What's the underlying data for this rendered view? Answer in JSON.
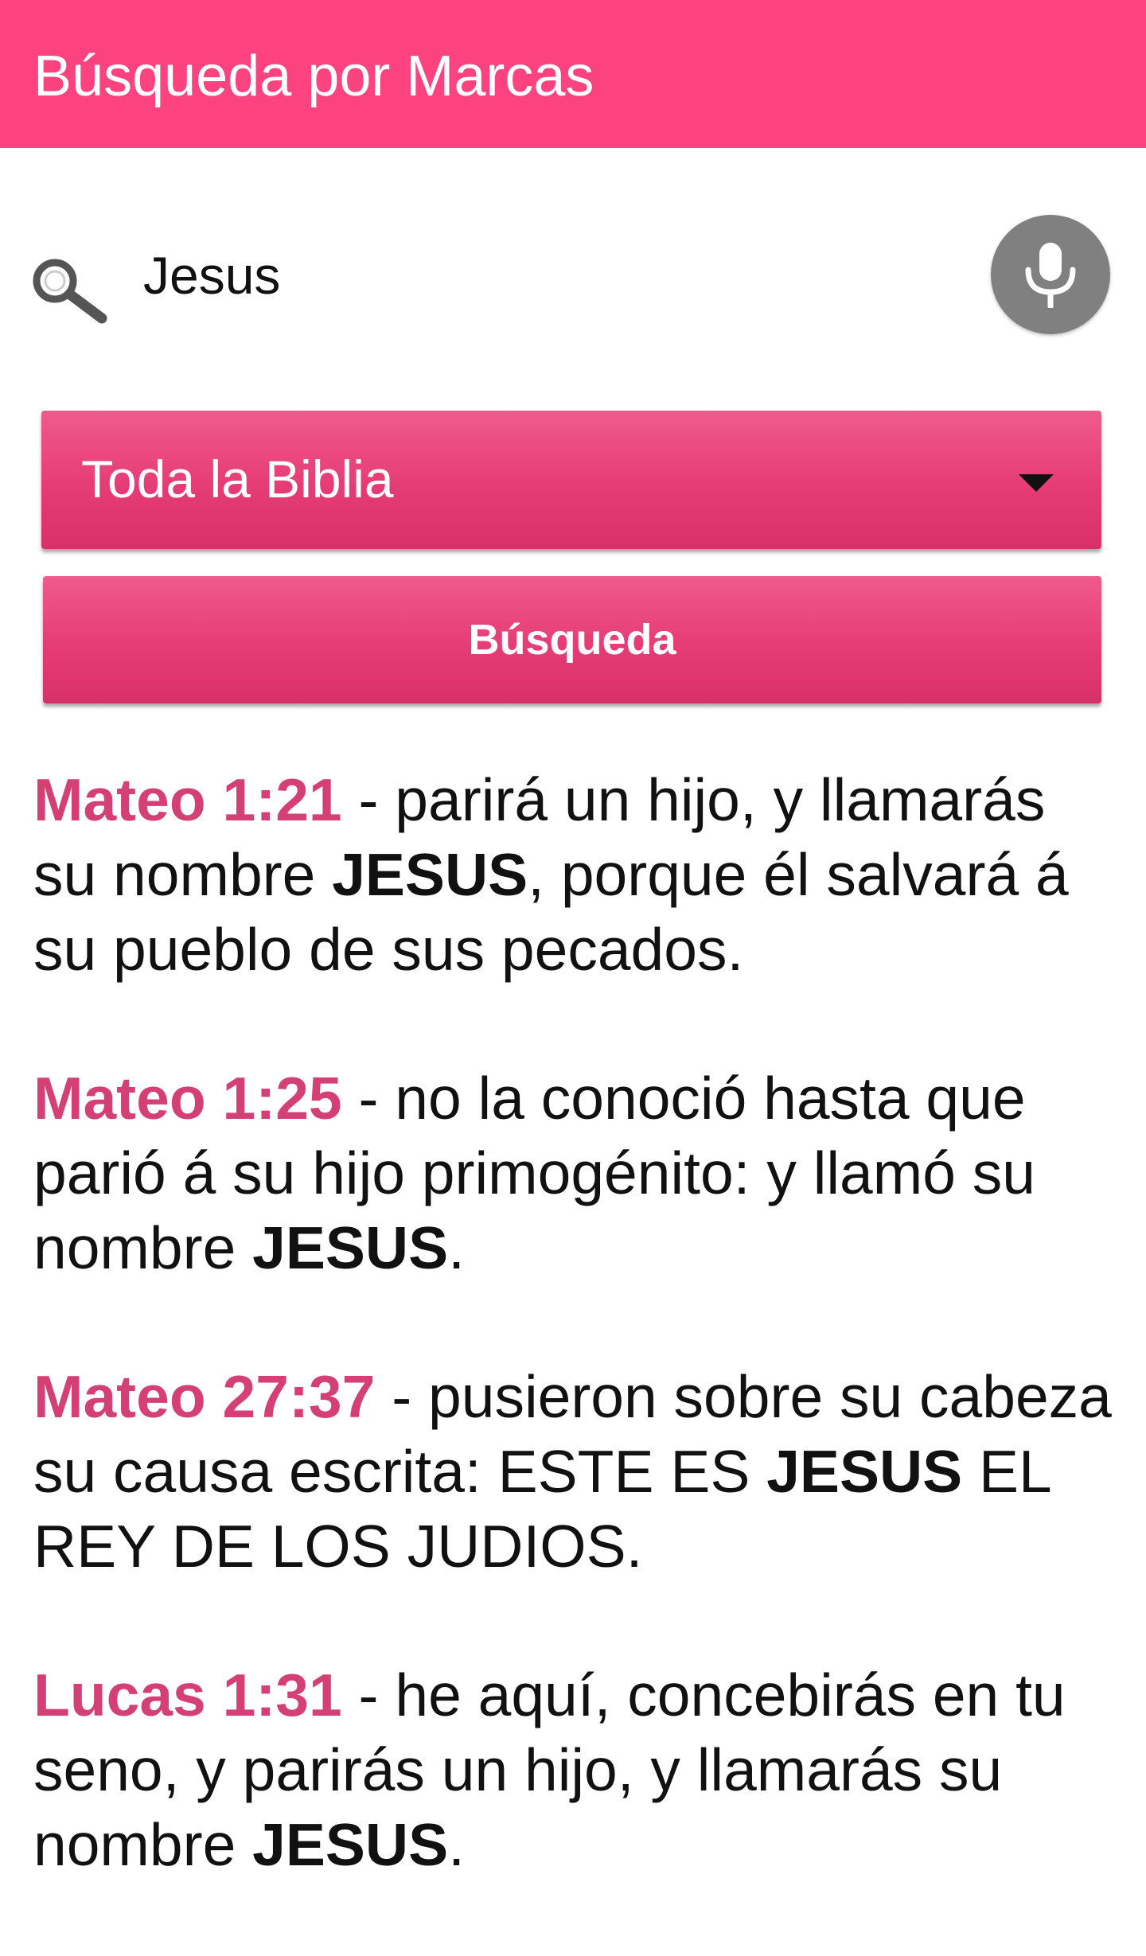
{
  "app_bar": {
    "title": "Búsqueda por Marcas",
    "background_color": "#fd437f"
  },
  "search": {
    "query": "Jesus",
    "search_icon": "search-icon",
    "mic_icon": "microphone-icon"
  },
  "scope_select": {
    "selected": "Toda la Biblia",
    "arrow_icon": "dropdown-arrow-icon"
  },
  "search_button": {
    "label": "Búsqueda"
  },
  "accent_color": "#d43f74",
  "results": [
    {
      "reference": "Mateo 1:21",
      "separator": " - ",
      "before": "parirá un hijo, y llamarás su nombre ",
      "highlight": "JESUS",
      "after": ", porque él salvará á su pueblo de sus pecados."
    },
    {
      "reference": "Mateo 1:25",
      "separator": " - ",
      "before": "no la conoció hasta que parió á su hijo primogénito: y llamó su nombre ",
      "highlight": "JESUS",
      "after": "."
    },
    {
      "reference": "Mateo 27:37",
      "separator": " - ",
      "before": "pusieron sobre su cabeza su causa escrita: ESTE ES ",
      "highlight": "JESUS",
      "after": " EL REY DE LOS JUDIOS."
    },
    {
      "reference": "Lucas 1:31",
      "separator": " - ",
      "before": "he aquí, concebirás en tu seno, y parirás un hijo, y llamarás su nombre ",
      "highlight": "JESUS",
      "after": "."
    }
  ]
}
